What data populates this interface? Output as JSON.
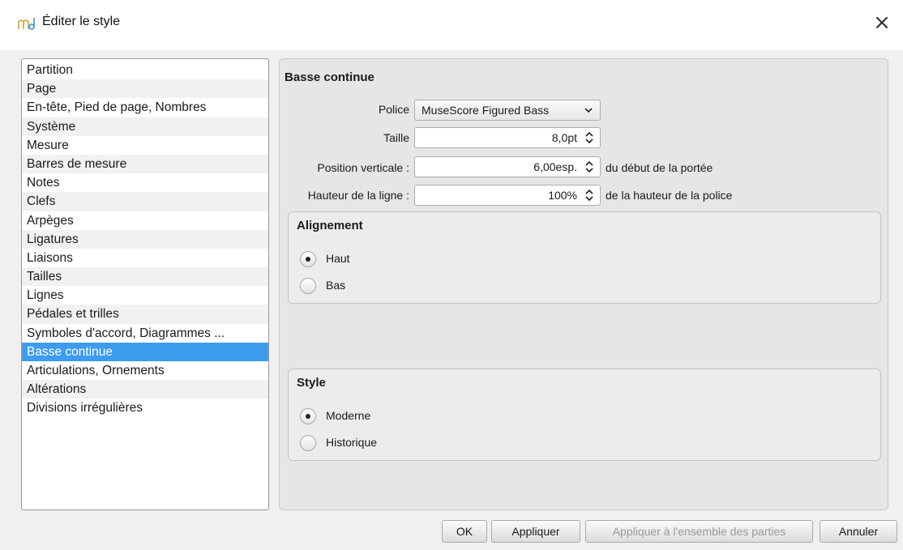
{
  "window": {
    "title": "Éditer le style",
    "close_glyph": "×"
  },
  "sidebar": {
    "items": [
      {
        "label": "Partition"
      },
      {
        "label": "Page"
      },
      {
        "label": "En-tête, Pied de page, Nombres"
      },
      {
        "label": "Système"
      },
      {
        "label": "Mesure"
      },
      {
        "label": "Barres de mesure"
      },
      {
        "label": "Notes"
      },
      {
        "label": "Clefs"
      },
      {
        "label": "Arpèges"
      },
      {
        "label": "Ligatures"
      },
      {
        "label": "Liaisons"
      },
      {
        "label": "Tailles"
      },
      {
        "label": "Lignes"
      },
      {
        "label": "Pédales et trilles"
      },
      {
        "label": "Symboles d'accord, Diagrammes ..."
      },
      {
        "label": "Basse continue",
        "selected": true
      },
      {
        "label": "Articulations, Ornements"
      },
      {
        "label": "Altérations"
      },
      {
        "label": "Divisions irrégulières"
      }
    ]
  },
  "panel": {
    "title": "Basse continue",
    "font": {
      "label": "Police",
      "value": "MuseScore Figured Bass"
    },
    "size": {
      "label": "Taille",
      "value": "8,0pt"
    },
    "vpos": {
      "label": "Position verticale :",
      "value": "6,00esp.",
      "suffix": "du début de la portée"
    },
    "line_height": {
      "label": "Hauteur de la ligne :",
      "value": "100%",
      "suffix": "de la hauteur de la police"
    },
    "alignment": {
      "title": "Alignement",
      "options": [
        {
          "label": "Haut",
          "checked": true
        },
        {
          "label": "Bas",
          "checked": false
        }
      ]
    },
    "style": {
      "title": "Style",
      "options": [
        {
          "label": "Moderne",
          "checked": true
        },
        {
          "label": "Historique",
          "checked": false
        }
      ]
    }
  },
  "buttons": {
    "ok": "OK",
    "apply": "Appliquer",
    "apply_all": "Appliquer à l'ensemble des parties",
    "cancel": "Annuler"
  }
}
